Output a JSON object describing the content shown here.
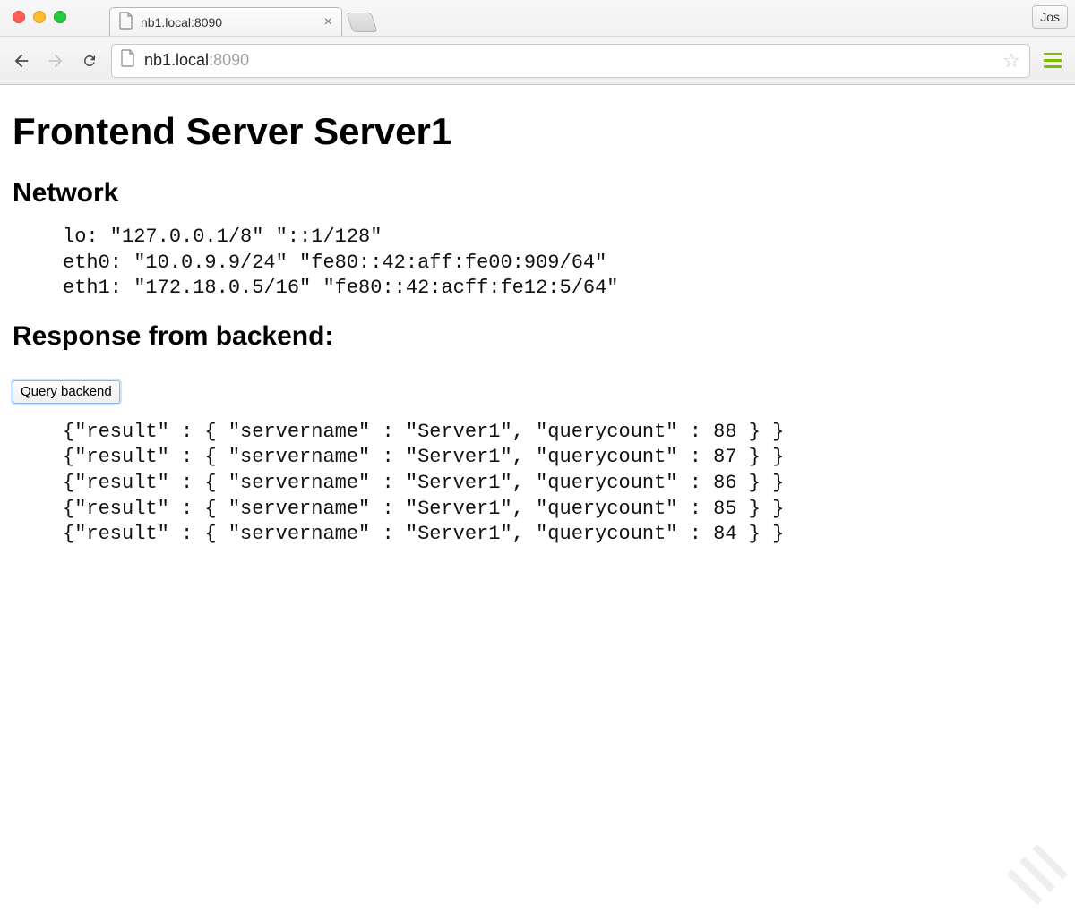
{
  "chrome": {
    "tab_title": "nb1.local:8090",
    "user_label": "Jos",
    "url_host": "nb1.local",
    "url_port": ":8090"
  },
  "page": {
    "heading": "Frontend Server Server1",
    "network_heading": "Network",
    "network_lines": [
      "lo: \"127.0.0.1/8\" \"::1/128\"",
      "eth0: \"10.0.9.9/24\" \"fe80::42:aff:fe00:909/64\"",
      "eth1: \"172.18.0.5/16\" \"fe80::42:acff:fe12:5/64\""
    ],
    "response_heading": "Response from backend:",
    "query_button_label": "Query backend",
    "responses": [
      {
        "servername": "Server1",
        "querycount": 88
      },
      {
        "servername": "Server1",
        "querycount": 87
      },
      {
        "servername": "Server1",
        "querycount": 86
      },
      {
        "servername": "Server1",
        "querycount": 85
      },
      {
        "servername": "Server1",
        "querycount": 84
      }
    ]
  }
}
